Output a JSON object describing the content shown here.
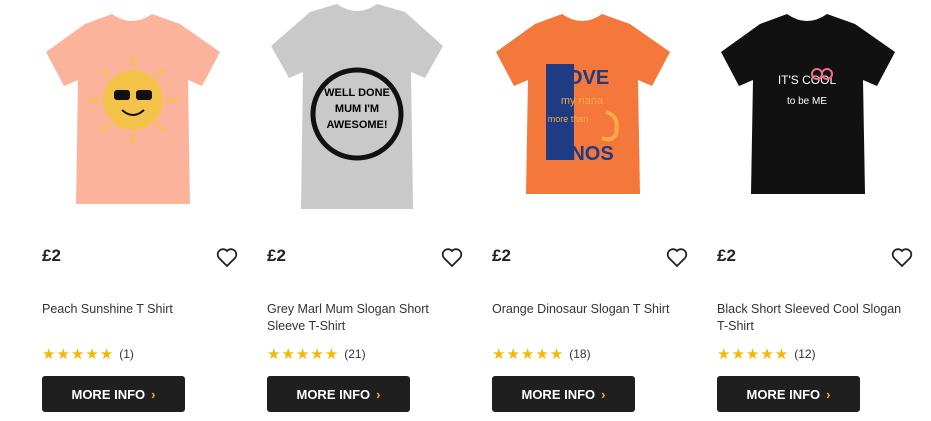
{
  "products": [
    {
      "price": "£2",
      "title": "Peach Sunshine T Shirt",
      "stars": "★★★★★",
      "count": "(1)",
      "button": "MORE INFO",
      "print": "",
      "tee_color": "#fbb39b",
      "accent": "#f6c34a"
    },
    {
      "price": "£2",
      "title": "Grey Marl Mum Slogan Short Sleeve T-Shirt",
      "stars": "★★★★★",
      "count": "(21)",
      "button": "MORE INFO",
      "print": "WELL DONE MUM I'M AWESOME!",
      "tee_color": "#c9c9c9",
      "accent": "#111111"
    },
    {
      "price": "£2",
      "title": "Orange Dinosaur Slogan T Shirt",
      "stars": "★★★★★",
      "count": "(18)",
      "button": "MORE INFO",
      "print": "LOVE my nana more than DINOS",
      "tee_color": "#f4773c",
      "accent": "#1f3b82"
    },
    {
      "price": "£2",
      "title": "Black Short Sleeved Cool Slogan T-Shirt",
      "stars": "★★★★★",
      "count": "(12)",
      "button": "MORE INFO",
      "print": "IT'S COOL to be ME",
      "tee_color": "#111111",
      "accent": "#f26a8d"
    }
  ],
  "icons": {
    "wishlist": "heart-outline-icon",
    "chevron": "chevron-right-icon"
  }
}
